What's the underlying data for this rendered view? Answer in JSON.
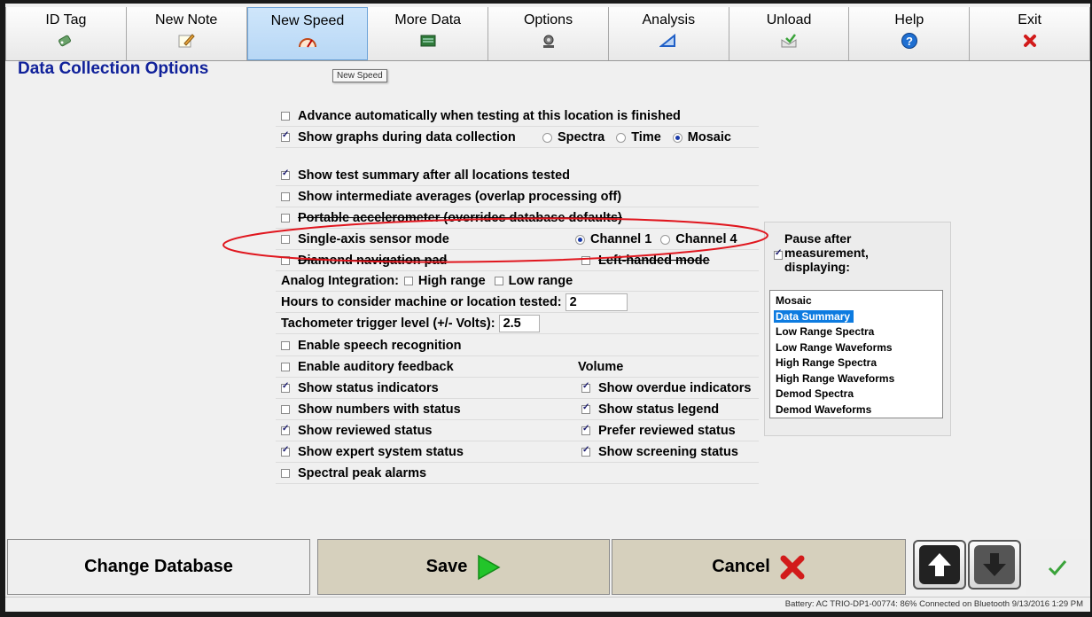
{
  "toolbar": {
    "buttons": [
      {
        "label": "ID Tag",
        "icon": "id-tag-icon"
      },
      {
        "label": "New Note",
        "icon": "note-pencil-icon"
      },
      {
        "label": "New Speed",
        "icon": "speedometer-icon"
      },
      {
        "label": "More Data",
        "icon": "more-data-icon"
      },
      {
        "label": "Options",
        "icon": "options-icon"
      },
      {
        "label": "Analysis",
        "icon": "triangle-icon"
      },
      {
        "label": "Unload",
        "icon": "unload-icon"
      },
      {
        "label": "Help",
        "icon": "help-icon"
      },
      {
        "label": "Exit",
        "icon": "close-icon"
      }
    ],
    "active": "New Speed"
  },
  "page_title": "Data Collection Options",
  "tooltip": "New Speed",
  "options": {
    "advance_auto": {
      "label": "Advance automatically when testing at this location is finished",
      "checked": false
    },
    "show_graphs": {
      "label": "Show graphs during data collection",
      "checked": true,
      "modes": [
        "Spectra",
        "Time",
        "Mosaic"
      ],
      "selected_mode": "Mosaic"
    },
    "test_summary": {
      "label": "Show test summary after all locations tested",
      "checked": true
    },
    "intermediate_avg": {
      "label": "Show intermediate averages (overlap processing off)",
      "checked": false
    },
    "portable_accel": {
      "label": "Portable accelerometer (overrides database defaults)",
      "checked": false
    },
    "single_axis": {
      "label": "Single-axis sensor mode",
      "checked": false,
      "channels": [
        "Channel 1",
        "Channel 4"
      ],
      "selected_channel": "Channel 1"
    },
    "diamond_nav": {
      "label": "Diamond navigation pad",
      "checked": false
    },
    "left_handed": {
      "label": "Left-handed mode",
      "checked": false
    },
    "analog_integration": {
      "label": "Analog Integration:",
      "high": "High range",
      "low": "Low range"
    },
    "hours_consider": {
      "label": "Hours to consider machine or location tested:",
      "value": "2"
    },
    "tach_trigger": {
      "label": "Tachometer trigger level (+/- Volts):",
      "value": "2.5"
    },
    "speech": {
      "label": "Enable speech recognition",
      "checked": false
    },
    "auditory": {
      "label": "Enable auditory feedback",
      "checked": false
    },
    "volume": {
      "label": "Volume"
    },
    "status_indicators": {
      "label": "Show status indicators",
      "checked": true
    },
    "overdue_indicators": {
      "label": "Show overdue indicators",
      "checked": true
    },
    "numbers_status": {
      "label": "Show numbers with status",
      "checked": false
    },
    "status_legend": {
      "label": "Show status legend",
      "checked": true
    },
    "reviewed_status": {
      "label": "Show reviewed status",
      "checked": true
    },
    "prefer_reviewed": {
      "label": "Prefer reviewed status",
      "checked": true
    },
    "expert_system": {
      "label": "Show expert system status",
      "checked": true
    },
    "screening_status": {
      "label": "Show screening status",
      "checked": true
    },
    "spectral_peak": {
      "label": "Spectral peak alarms",
      "checked": false
    }
  },
  "pause_panel": {
    "label_line1": "Pause after",
    "label_line2": "measurement,",
    "label_line3": "displaying:",
    "checked": true,
    "items": [
      "Mosaic",
      "Data Summary",
      "Low Range Spectra",
      "Low Range Waveforms",
      "High Range Spectra",
      "High Range Waveforms",
      "Demod Spectra",
      "Demod Waveforms"
    ],
    "selected": "Data Summary"
  },
  "bottom": {
    "change_db": "Change Database",
    "save": "Save",
    "cancel": "Cancel"
  },
  "status_bar": "Battery: AC  TRIO-DP1-00774: 86%  Connected on Bluetooth   9/13/2016   1:29 PM",
  "colors": {
    "title": "#10219a",
    "highlight": "#0d7be0",
    "annotation": "#e0161e",
    "save_arrow": "#22c52a"
  }
}
